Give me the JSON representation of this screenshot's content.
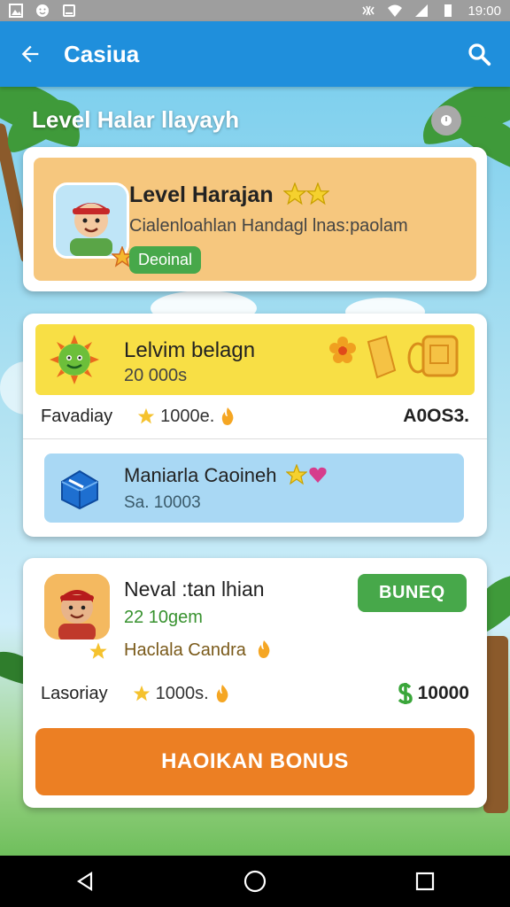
{
  "status_bar": {
    "time": "19:00"
  },
  "app_bar": {
    "title": "Casiua"
  },
  "section_title": "Level  Halar  llayayh",
  "card_level": {
    "title": "Level Harajan",
    "subtitle": "Cialenloahlan Handagl lnas:paolam",
    "badge": "Deoinal"
  },
  "card_offers": {
    "yellow": {
      "title": "Lelvim belagn",
      "subtitle": "20 000s"
    },
    "row": {
      "label": "Favadiay",
      "points": "1000e.",
      "amount": "A0OS3."
    },
    "blue": {
      "title": "Maniarla Caoineh",
      "subtitle": "Sa. 10003"
    }
  },
  "card_bonus": {
    "title": "Neval :tan lhian",
    "subtitle": "22 10gem",
    "note": "Haclala Candra",
    "button": "BUNEQ",
    "row": {
      "label": "Lasoriay",
      "points": "1000s.",
      "amount": "10000"
    },
    "cta": "HAOIKAN BONUS"
  },
  "colors": {
    "appbar": "#1f8fdc",
    "accent_orange": "#ec7f23",
    "green": "#47a84a",
    "yellow_banner": "#f8df45",
    "blue_banner": "#a9d8f4"
  }
}
